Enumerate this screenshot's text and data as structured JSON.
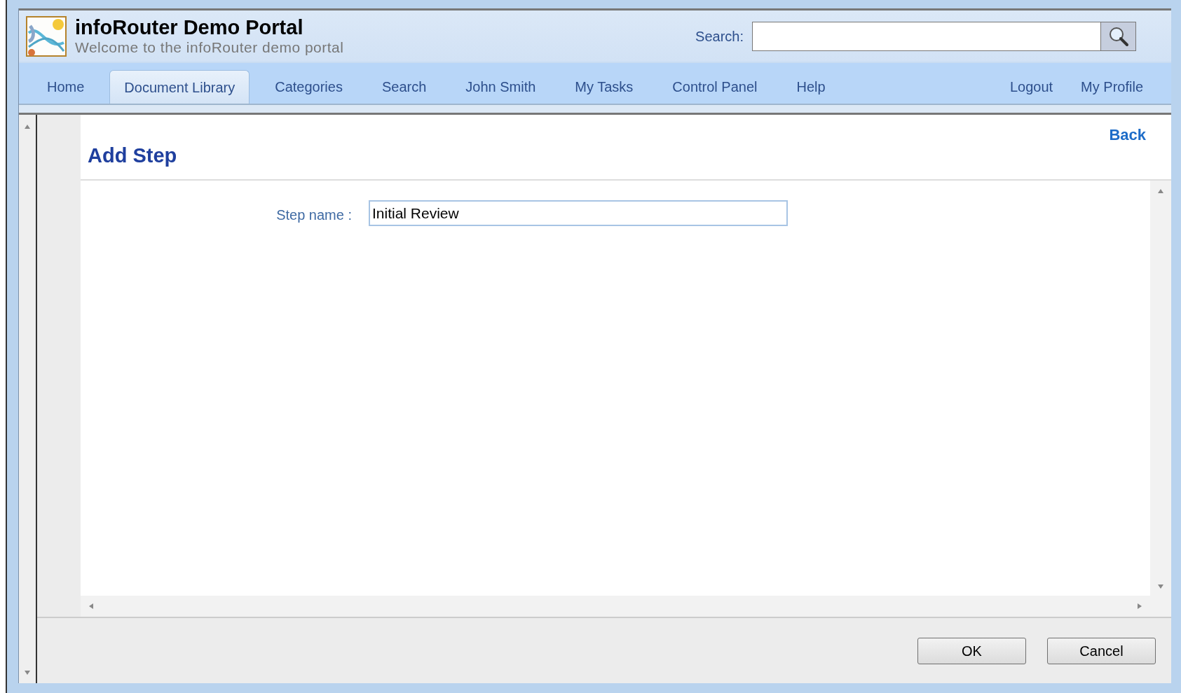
{
  "header": {
    "title": "infoRouter Demo Portal",
    "subtitle": "Welcome to the infoRouter demo portal",
    "search": {
      "label": "Search:"
    }
  },
  "nav": {
    "tabs": [
      {
        "label": "Home",
        "selected": false
      },
      {
        "label": "Document Library",
        "selected": true
      },
      {
        "label": "Categories",
        "selected": false
      },
      {
        "label": "Search",
        "selected": false
      },
      {
        "label": "John Smith",
        "selected": false
      },
      {
        "label": "My Tasks",
        "selected": false
      },
      {
        "label": "Control Panel",
        "selected": false
      },
      {
        "label": "Help",
        "selected": false
      }
    ],
    "right_links": [
      "Logout",
      "My Profile"
    ]
  },
  "page": {
    "title": "Add Step",
    "back_link": "Back",
    "form": {
      "label": "Step name :",
      "value": "Initial Review"
    }
  },
  "buttons": [
    "OK",
    "Cancel"
  ]
}
